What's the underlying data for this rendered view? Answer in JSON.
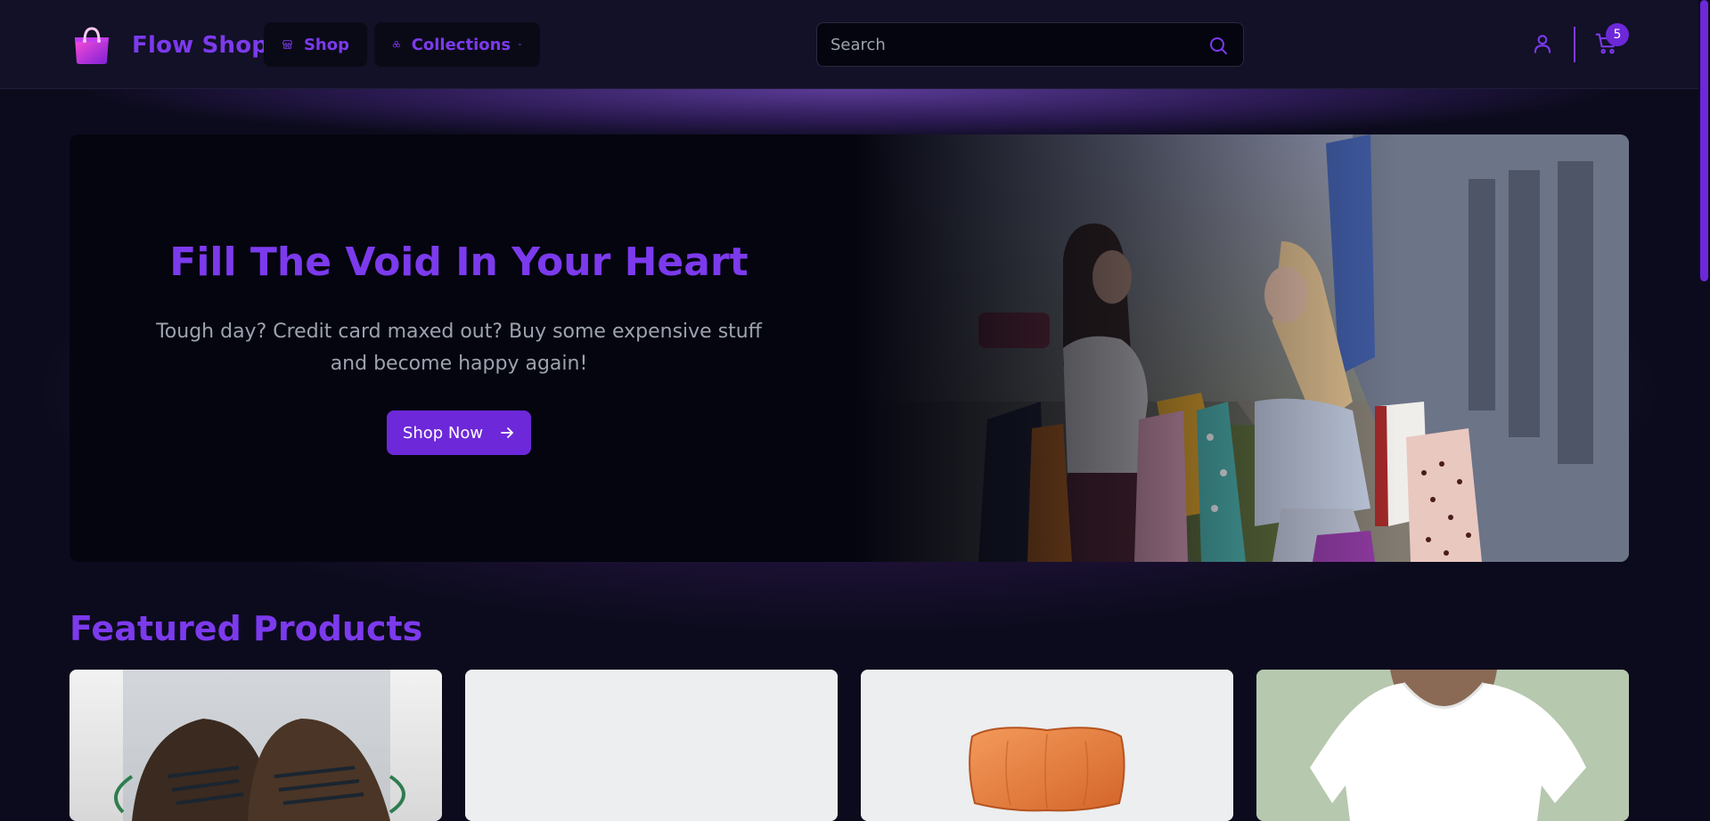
{
  "brand": {
    "name": "Flow Shop"
  },
  "nav": {
    "shop_label": "Shop",
    "collections_label": "Collections"
  },
  "search": {
    "placeholder": "Search"
  },
  "cart": {
    "count": "5"
  },
  "hero": {
    "title": "Fill The Void In Your Heart",
    "subtitle": "Tough day? Credit card maxed out? Buy some expensive stuff and become happy again!",
    "button_label": "Shop Now"
  },
  "featured": {
    "title": "Featured Products",
    "products": [
      {
        "image": "shoes"
      },
      {
        "image": "blank"
      },
      {
        "image": "wooden-chair-seat"
      },
      {
        "image": "white-tshirt"
      }
    ]
  },
  "icons": {
    "logo": "shopping-bag-icon",
    "shop": "storefront-icon",
    "collections": "clover-icon",
    "search": "search-icon",
    "user": "user-icon",
    "cart": "cart-icon",
    "arrow": "arrow-right-icon"
  },
  "colors": {
    "accent": "#7c3aed",
    "button": "#6d28d9",
    "background": "#0c0b1d",
    "header": "#121127",
    "hero_panel": "#04050f"
  }
}
